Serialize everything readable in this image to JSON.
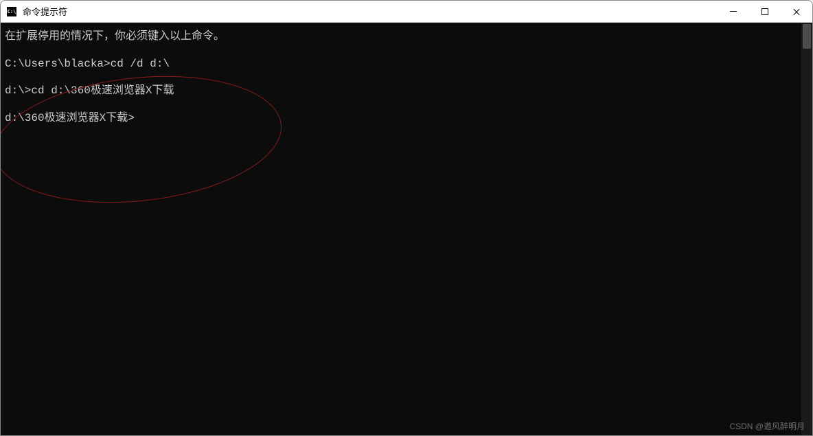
{
  "window": {
    "title": "命令提示符",
    "icon_label": "C:\\"
  },
  "terminal": {
    "lines": [
      "在扩展停用的情况下，你必须键入以上命令。",
      "C:\\Users\\blacka>cd /d d:\\",
      "d:\\>cd d:\\360极速浏览器X下载",
      "d:\\360极速浏览器X下载>"
    ]
  },
  "annotation": {
    "ellipse_style": "left:-10px; top:80px; width:420px; height:180px;"
  },
  "watermark": "CSDN @邀风醉明月"
}
